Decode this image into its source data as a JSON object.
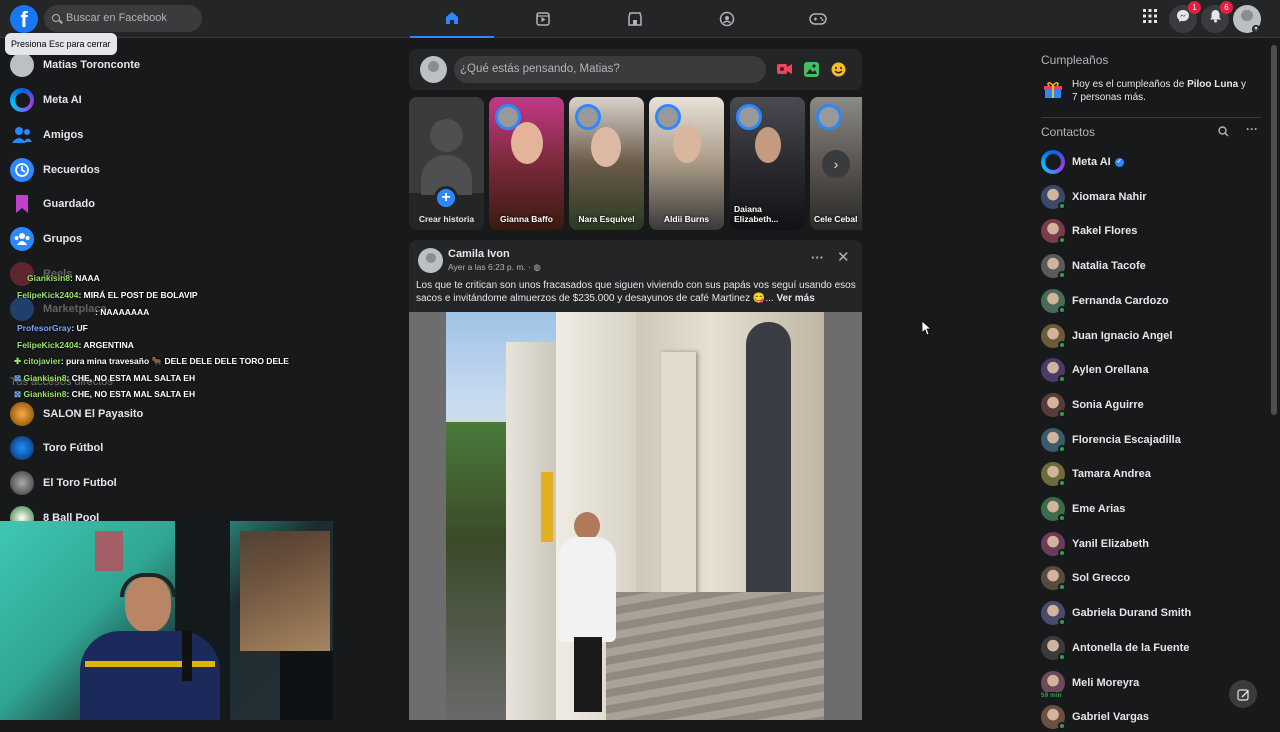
{
  "search": {
    "placeholder": "Buscar en Facebook"
  },
  "tooltip": "Presiona Esc para cerrar",
  "nav": {
    "badges": {
      "messenger": "1",
      "notifications": "6"
    }
  },
  "sidebar": {
    "items": [
      {
        "label": "Matias Toronconte",
        "icon": "avatar"
      },
      {
        "label": "Meta AI",
        "icon": "meta-ai-icon"
      },
      {
        "label": "Amigos",
        "icon": "friends-icon"
      },
      {
        "label": "Recuerdos",
        "icon": "memories-icon"
      },
      {
        "label": "Guardado",
        "icon": "saved-icon"
      },
      {
        "label": "Grupos",
        "icon": "groups-icon"
      },
      {
        "label": "Reels",
        "icon": "reels-icon"
      },
      {
        "label": "Marketplace",
        "icon": "marketplace-icon"
      }
    ],
    "shortcuts_title": "Tus accesos directos",
    "shortcuts": [
      "SALON El Payasito",
      "Toro Fútbol",
      "El Toro Futbol",
      "8 Ball Pool"
    ]
  },
  "chat_overlay": [
    {
      "user": "Giankisin8",
      "msg": ": NAAA"
    },
    {
      "user": "FelipeKick2404",
      "msg": ": MIRÁ EL POST DE BOLAVIP"
    },
    {
      "user": "",
      "msg": ": NAAAAAAA"
    },
    {
      "user": "ProfesorGray",
      "msg": ": UF"
    },
    {
      "user": "FelipeKick2404",
      "msg": ": ARGENTINA"
    },
    {
      "user": "citojavier",
      "msg": ": pura mina travesaño 🐂 DELE DELE DELE TORO DELE"
    },
    {
      "user": "Giankisin8",
      "msg": ": CHE, NO ESTA MAL SALTA EH"
    },
    {
      "user": "Giankisin8",
      "msg": ": CHE, NO ESTA MAL SALTA EH"
    }
  ],
  "composer": {
    "placeholder": "¿Qué estás pensando, Matias?"
  },
  "stories": [
    {
      "name": "Crear historia"
    },
    {
      "name": "Gianna Baffo"
    },
    {
      "name": "Nara Esquivel"
    },
    {
      "name": "Aldii Burns"
    },
    {
      "name": "Daiana Elizabeth..."
    },
    {
      "name": "Cele Ceballos"
    }
  ],
  "post": {
    "author": "Camila Ivon",
    "time": "Ayer a las 6:23 p. m. ·",
    "text": "Los que te critican son unos fracasados que siguen viviendo con sus papás vos seguí usando esos sacos e invitándome almuerzos de $235.000 y desayunos de café Martinez 😋...",
    "see_more": "Ver más"
  },
  "birthdays": {
    "title": "Cumpleaños",
    "text_prefix": "Hoy es el cumpleaños de",
    "name": "Piloo Luna",
    "text_suffix": "y 7 personas más."
  },
  "contacts": {
    "title": "Contactos",
    "list": [
      {
        "name": "Meta AI",
        "verified": true,
        "online": false
      },
      {
        "name": "Xiomara Nahir",
        "online": true
      },
      {
        "name": "Rakel Flores",
        "online": true
      },
      {
        "name": "Natalia Tacofe",
        "online": true
      },
      {
        "name": "Fernanda Cardozo",
        "online": true
      },
      {
        "name": "Juan Ignacio Angel",
        "online": true
      },
      {
        "name": "Aylen Orellana",
        "online": true
      },
      {
        "name": "Sonia Aguirre",
        "online": true
      },
      {
        "name": "Florencia Escajadilla",
        "online": true
      },
      {
        "name": "Tamara Andrea",
        "online": true
      },
      {
        "name": "Eme Arias",
        "online": true
      },
      {
        "name": "Yanil Elizabeth",
        "online": true
      },
      {
        "name": "Sol Grecco",
        "online": true
      },
      {
        "name": "Gabriela Durand Smith",
        "online": true
      },
      {
        "name": "Antonella de la Fuente",
        "online": true
      },
      {
        "name": "Meli Moreyra",
        "online": false,
        "away": "59 min"
      },
      {
        "name": "Gabriel Vargas",
        "online": true
      }
    ]
  },
  "colors": {
    "accent": "#2d88ff",
    "online": "#31a24c",
    "badge": "#e41e3f"
  }
}
